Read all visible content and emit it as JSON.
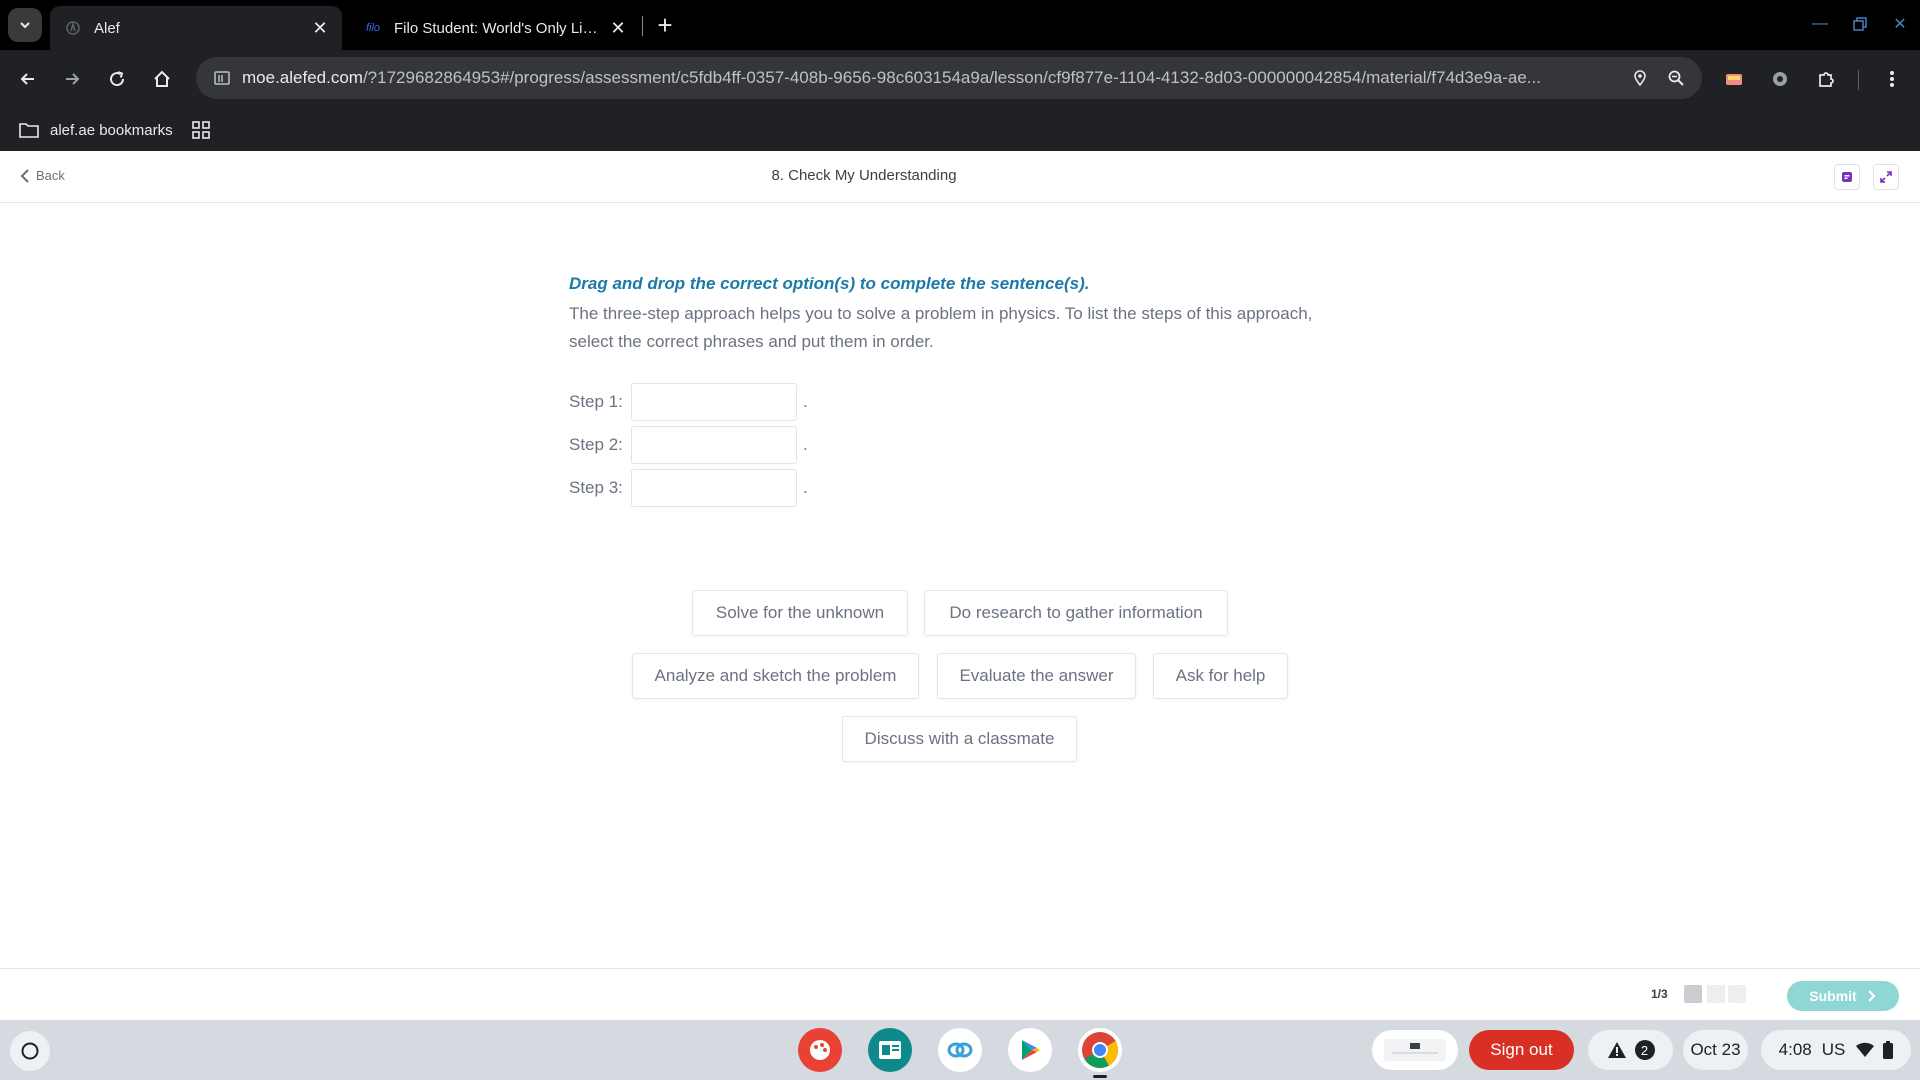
{
  "browser": {
    "tabs": [
      {
        "title": "Alef",
        "active": true
      },
      {
        "title": "Filo Student: World's Only Live Instant Tutoring",
        "active": false,
        "favicon_text": "filo"
      }
    ],
    "url_host": "moe.alefed.com",
    "url_rest": "/?1729682864953#/progress/assessment/c5fdb4ff-0357-408b-9656-98c603154a9a/lesson/cf9f877e-1104-4132-8d03-000000042854/material/f74d3e9a-ae...",
    "bookmarks": [
      {
        "label": "alef.ae bookmarks"
      }
    ]
  },
  "app_header": {
    "back_label": "Back",
    "title": "8. Check My Understanding"
  },
  "question": {
    "instruction": "Drag and drop the correct option(s) to complete the sentence(s).",
    "prompt": "The three-step approach helps you to solve a problem in physics. To list the steps of this approach, select the correct phrases and put them in order.",
    "steps": [
      {
        "label": "Step 1:",
        "suffix": "."
      },
      {
        "label": "Step 2:",
        "suffix": "."
      },
      {
        "label": "Step 3:",
        "suffix": "."
      }
    ],
    "options": [
      "Solve for the unknown",
      "Do research to gather information",
      "Analyze and sketch the problem",
      "Evaluate the answer",
      "Ask for help",
      "Discuss with a classmate"
    ]
  },
  "footer": {
    "pager_text": "1/3",
    "submit_label": "Submit"
  },
  "shelf": {
    "signout_label": "Sign out",
    "notification_count": "2",
    "date": "Oct 23",
    "time": "4:08",
    "locale": "US"
  },
  "colors": {
    "instruction": "#1b7aa8",
    "submit": "#8fd7d4",
    "signout": "#d93025"
  }
}
